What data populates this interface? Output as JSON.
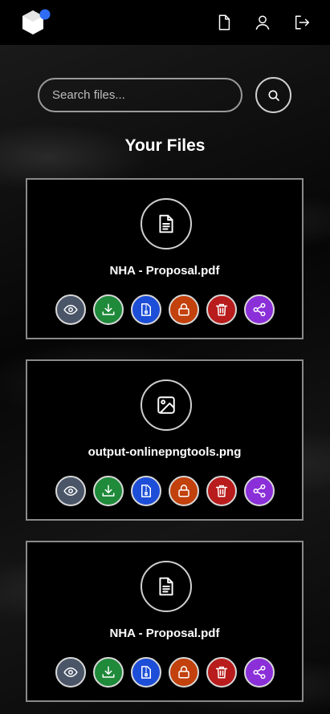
{
  "header": {
    "logo_name": "app-logo",
    "icons": [
      "document-icon",
      "user-icon",
      "logout-icon"
    ]
  },
  "search": {
    "placeholder": "Search files..."
  },
  "page": {
    "title": "Your Files"
  },
  "files": [
    {
      "name": "NHA - Proposal.pdf",
      "icon": "document-icon"
    },
    {
      "name": "output-onlinepngtools.png",
      "icon": "image-icon"
    },
    {
      "name": "NHA - Proposal.pdf",
      "icon": "document-icon"
    }
  ],
  "actions": [
    {
      "name": "view",
      "icon": "eye-icon",
      "color": "#4a5568"
    },
    {
      "name": "download",
      "icon": "download-icon",
      "color": "#1f8a3a"
    },
    {
      "name": "compress",
      "icon": "zip-icon",
      "color": "#1d4ed8"
    },
    {
      "name": "lock",
      "icon": "lock-icon",
      "color": "#c2410c"
    },
    {
      "name": "delete",
      "icon": "trash-icon",
      "color": "#b91c1c"
    },
    {
      "name": "share",
      "icon": "share-icon",
      "color": "#8b2fd9"
    }
  ]
}
